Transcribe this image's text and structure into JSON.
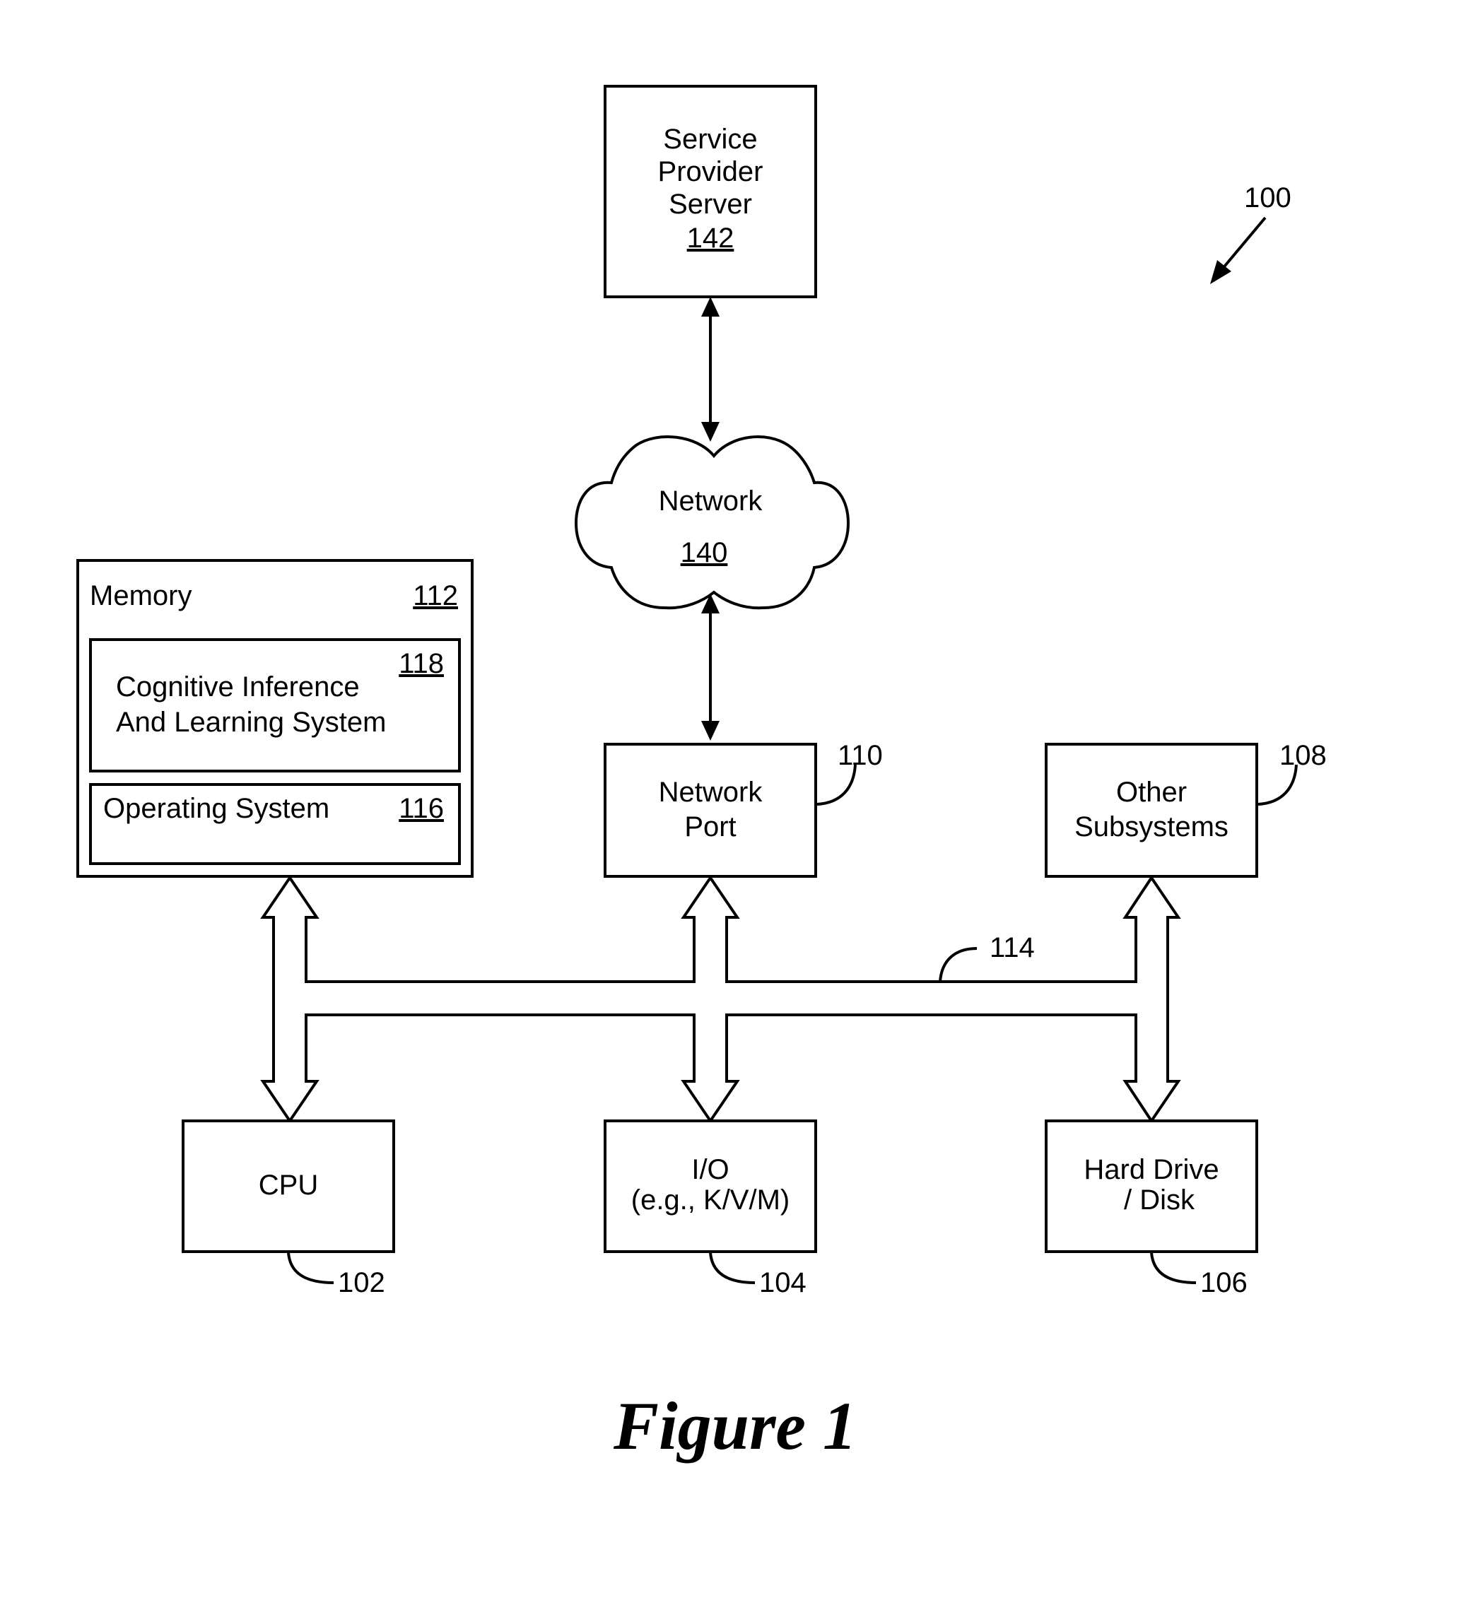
{
  "figure": {
    "reference": "100",
    "caption": "Figure 1"
  },
  "nodes": {
    "service_provider_server": {
      "lines": [
        "Service",
        "Provider",
        "Server"
      ],
      "ref": "142"
    },
    "network": {
      "label": "Network",
      "ref": "140"
    },
    "memory": {
      "label": "Memory",
      "ref": "112"
    },
    "cognitive_system": {
      "lines": [
        "Cognitive Inference",
        "And Learning System"
      ],
      "ref": "118"
    },
    "operating_system": {
      "label": "Operating System",
      "ref": "116"
    },
    "network_port": {
      "lines": [
        "Network",
        "Port"
      ],
      "ref": "110"
    },
    "other_subsystems": {
      "lines": [
        "Other",
        "Subsystems"
      ],
      "ref": "108"
    },
    "cpu": {
      "label": "CPU",
      "ref": "102"
    },
    "io": {
      "lines": [
        "I/O",
        "(e.g., K/V/M)"
      ],
      "ref": "104"
    },
    "hard_drive": {
      "lines": [
        "Hard Drive",
        "/ Disk"
      ],
      "ref": "106"
    },
    "bus": {
      "ref": "114"
    }
  },
  "edges": [
    {
      "from": "service_provider_server",
      "to": "network",
      "type": "bidirectional"
    },
    {
      "from": "network",
      "to": "network_port",
      "type": "bidirectional"
    },
    {
      "from": "memory",
      "to": "bus",
      "type": "bidirectional-bus"
    },
    {
      "from": "network_port",
      "to": "bus",
      "type": "bidirectional-bus"
    },
    {
      "from": "other_subsystems",
      "to": "bus",
      "type": "bidirectional-bus"
    },
    {
      "from": "cpu",
      "to": "bus",
      "type": "bidirectional-bus"
    },
    {
      "from": "io",
      "to": "bus",
      "type": "bidirectional-bus"
    },
    {
      "from": "hard_drive",
      "to": "bus",
      "type": "bidirectional-bus"
    }
  ]
}
